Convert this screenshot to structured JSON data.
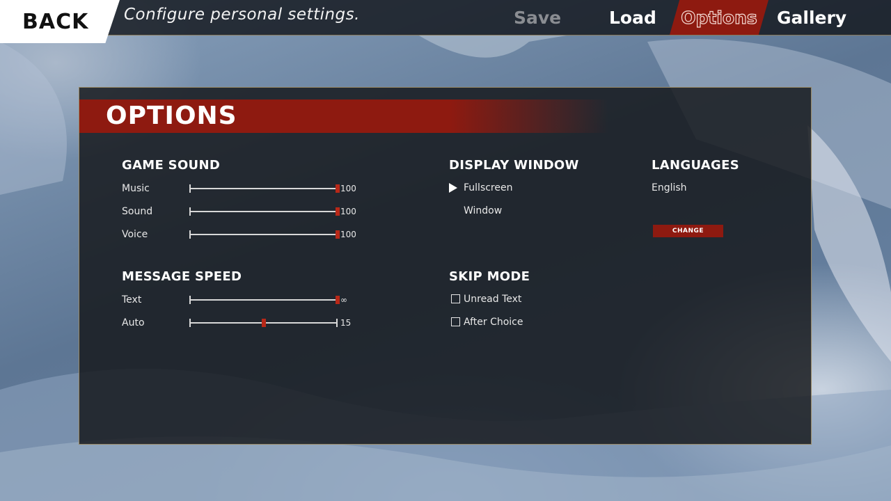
{
  "topbar": {
    "back_label": "BACK",
    "subtitle": "Configure personal settings.",
    "nav": {
      "save": "Save",
      "load": "Load",
      "options": "Options",
      "gallery": "Gallery"
    },
    "active_tab": "Options",
    "accent_color": "#8e1a10"
  },
  "panel": {
    "title": "OPTIONS",
    "game_sound": {
      "heading": "GAME SOUND",
      "rows": [
        {
          "label": "Music",
          "value": "100",
          "level": 1.0
        },
        {
          "label": "Sound",
          "value": "100",
          "level": 1.0
        },
        {
          "label": "Voice",
          "value": "100",
          "level": 1.0
        }
      ]
    },
    "message_speed": {
      "heading": "MESSAGE SPEED",
      "rows": [
        {
          "label": "Text",
          "value": "∞",
          "level": 1.0
        },
        {
          "label": "Auto",
          "value": "15",
          "level": 0.5
        }
      ]
    },
    "display_window": {
      "heading": "DISPLAY WINDOW",
      "options": [
        "Fullscreen",
        "Window"
      ],
      "selected": "Fullscreen"
    },
    "skip_mode": {
      "heading": "SKIP MODE",
      "options": [
        {
          "label": "Unread Text",
          "checked": false
        },
        {
          "label": "After Choice",
          "checked": false
        }
      ]
    },
    "languages": {
      "heading": "LANGUAGES",
      "current": "English",
      "change_label": "CHANGE"
    }
  },
  "icons": {
    "selected_marker": "triangle-right-icon",
    "checkbox": "checkbox-icon"
  }
}
